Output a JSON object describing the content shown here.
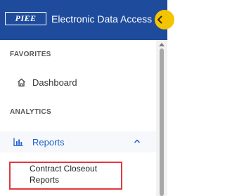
{
  "header": {
    "logo_text": "PIEE",
    "title": "Electronic Data Access",
    "collapse_icon": "chevron-left-icon"
  },
  "sidebar": {
    "sections": [
      {
        "label": "FAVORITES",
        "items": [
          {
            "label": "Dashboard",
            "icon": "home-icon"
          }
        ]
      },
      {
        "label": "ANALYTICS",
        "items": [
          {
            "label": "Reports",
            "icon": "bar-chart-icon",
            "expanded": true,
            "children": [
              {
                "label": "Contract Closeout Reports",
                "highlighted": true
              }
            ]
          }
        ]
      }
    ]
  },
  "colors": {
    "header_bg": "#1e4b9c",
    "accent": "#1e5fd0",
    "collapse_button": "#f5c400",
    "highlight_box": "#e0393e"
  }
}
